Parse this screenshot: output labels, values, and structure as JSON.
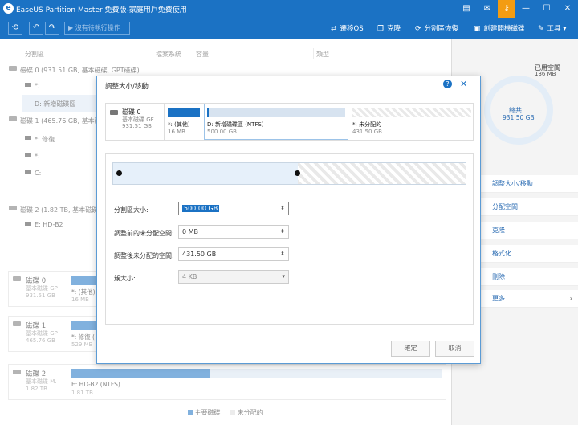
{
  "app": {
    "title": "EaseUS Partition Master 免費版-家庭用戶免費使用",
    "brand_color": "#1b72c4"
  },
  "toolbar": {
    "pending_label": "沒有待執行操作",
    "tools": [
      "遷移OS",
      "克隆",
      "分割區恢復",
      "創建開機磁碟",
      "工具"
    ],
    "tool_icons": [
      "migrate-icon",
      "clone-icon",
      "recovery-icon",
      "boot-disk-icon",
      "tools-icon"
    ]
  },
  "columns": [
    "分割區",
    "檔案系統",
    "容量",
    "類型"
  ],
  "tree": [
    {
      "label": "磁碟 0 (931.51 GB, 基本磁碟, GPT磁碟)",
      "kind": "disk"
    },
    {
      "label": "*:",
      "kind": "part"
    },
    {
      "label": "D: 新增磁碟區",
      "kind": "part",
      "selected": true
    },
    {
      "label": "磁碟 1 (465.76 GB, 基本磁碟, GPT磁碟)",
      "kind": "disk"
    },
    {
      "label": "*: 修復",
      "kind": "part"
    },
    {
      "label": "*:",
      "kind": "part"
    },
    {
      "label": "C:",
      "kind": "part"
    },
    {
      "label": "磁碟 2 (1.82 TB, 基本磁碟, MBR)",
      "kind": "disk"
    },
    {
      "label": "E: HD-B2",
      "kind": "part"
    }
  ],
  "disk_maps": [
    {
      "name": "磁碟 0",
      "type": "基本磁碟 GP",
      "size": "931.51 GB",
      "part_label": "*: (其他)",
      "part_size": "16 MB"
    },
    {
      "name": "磁碟 1",
      "type": "基本磁碟 GP",
      "size": "465.76 GB",
      "part_label": "*: 修復 (",
      "part_size": "529 MB"
    },
    {
      "name": "磁碟 2",
      "type": "基本磁碟 M.",
      "size": "1.82 TB",
      "part_label": "E: HD-B2 (NTFS)",
      "part_size": "1.81 TB"
    }
  ],
  "legend": {
    "primary": "主要磁碟",
    "unallocated": "未分配的"
  },
  "right_panel": {
    "used_label": "已用空間",
    "used_value": "136 MB",
    "total_label": "總共",
    "total_value": "931.50 GB",
    "actions": [
      "調整大小/移動",
      "分配空間",
      "克隆",
      "格式化",
      "刪除",
      "更多"
    ]
  },
  "dialog": {
    "title": "調整大小/移動",
    "disk_name": "磁碟 0",
    "disk_type": "基本磁碟 GF",
    "disk_size": "931.51 GB",
    "parts": [
      {
        "label": "*: (其他)",
        "size": "16 MB"
      },
      {
        "label": "D: 新增磁碟區 (NTFS)",
        "size": "500.00 GB"
      },
      {
        "label": "*: 未分配的",
        "size": "431.50 GB"
      }
    ],
    "fields": [
      {
        "label": "分割區大小:",
        "value": "500.00 GB"
      },
      {
        "label": "調整前的未分配空間:",
        "value": "0 MB"
      },
      {
        "label": "調整後未分配的空間:",
        "value": "431.50 GB"
      },
      {
        "label": "簇大小:",
        "value": "4 KB"
      }
    ],
    "ok": "確定",
    "cancel": "取消"
  }
}
